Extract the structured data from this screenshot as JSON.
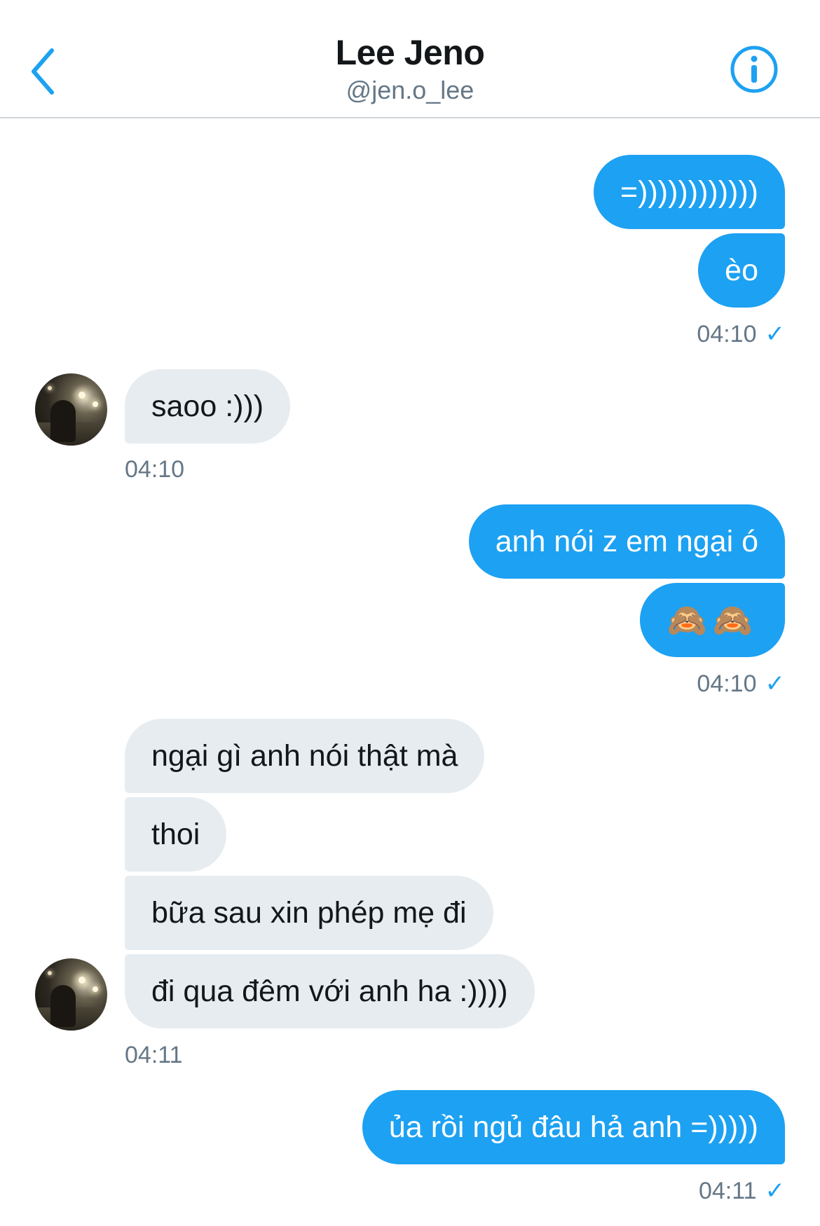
{
  "header": {
    "title": "Lee Jeno",
    "handle": "@jen.o_lee",
    "back_icon": "chevron-left-icon",
    "info_icon": "info-circle-icon",
    "accent_color": "#1da1f2"
  },
  "messages": [
    {
      "direction": "out",
      "text": "=))))))))))))"
    },
    {
      "direction": "out",
      "text": "èo"
    },
    {
      "direction": "out",
      "timestamp": "04:10",
      "read_check": "✓"
    },
    {
      "direction": "in",
      "text": "saoo :)))"
    },
    {
      "direction": "in",
      "timestamp": "04:10"
    },
    {
      "direction": "out",
      "text": "anh nói z em ngại ó"
    },
    {
      "direction": "out",
      "text": "🙈🙈"
    },
    {
      "direction": "out",
      "timestamp": "04:10",
      "read_check": "✓"
    },
    {
      "direction": "in",
      "text": "ngại gì anh nói thật mà"
    },
    {
      "direction": "in",
      "text": "thoi"
    },
    {
      "direction": "in",
      "text": "bữa sau xin phép mẹ đi"
    },
    {
      "direction": "in",
      "text": "đi qua đêm với anh ha :))))"
    },
    {
      "direction": "in",
      "timestamp": "04:11"
    },
    {
      "direction": "out",
      "text": "ủa rồi ngủ đâu hả anh =)))))"
    },
    {
      "direction": "out",
      "timestamp": "04:11",
      "read_check": "✓"
    }
  ]
}
